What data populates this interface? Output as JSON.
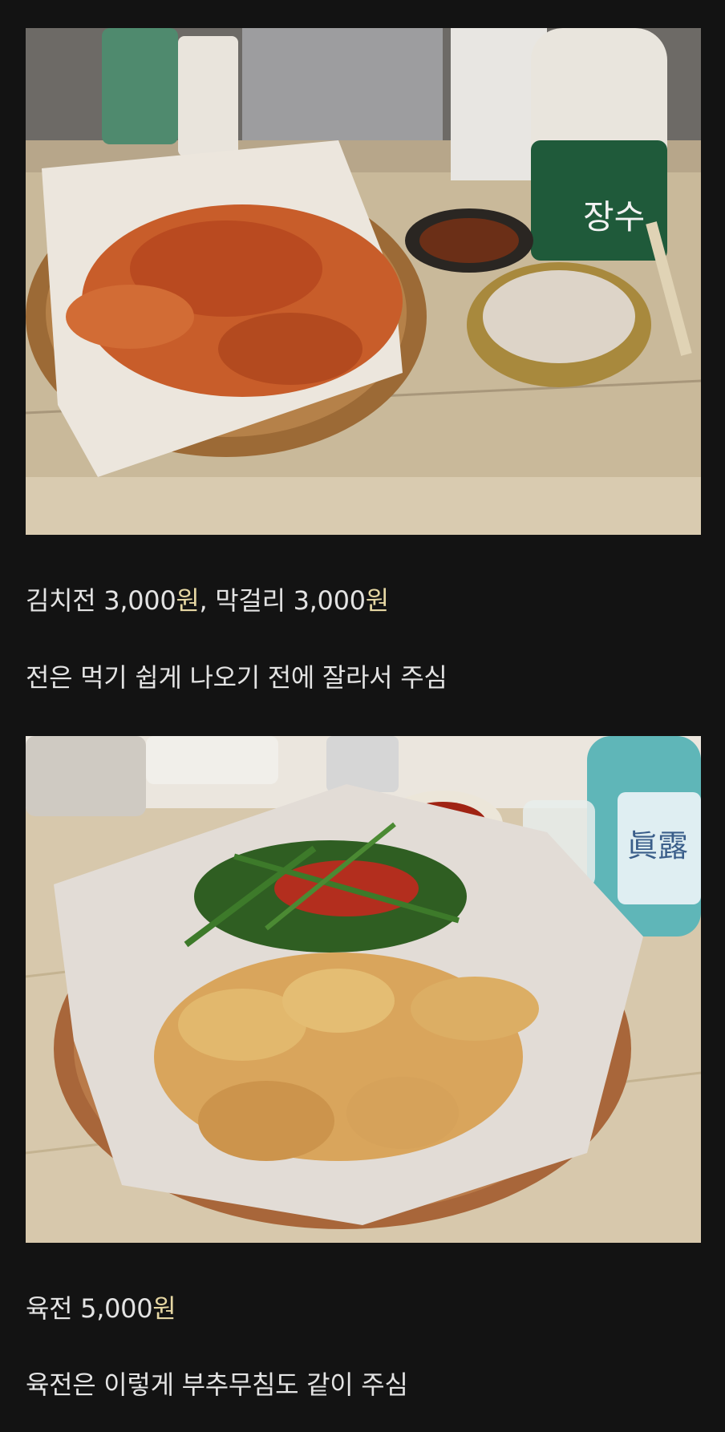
{
  "post": {
    "photo1": {
      "bottle_label": "장수"
    },
    "caption1": {
      "item1_name": "김치전 3,000",
      "item1_won": "원",
      "separator": ", 막걸리 3,000",
      "item2_won": "원"
    },
    "caption2": {
      "text": "전은 먹기 쉽게 나오기 전에 잘라서 주심"
    },
    "photo2": {
      "bottle_label": "眞露"
    },
    "caption3": {
      "item_name": "육전 5,000",
      "item_won": "원"
    },
    "caption4": {
      "text": "육전은 이렇게 부추무침도 같이 주심"
    }
  },
  "colors": {
    "background": "#131313",
    "text": "#e3e3e3",
    "highlight": "#e6d7a3"
  }
}
